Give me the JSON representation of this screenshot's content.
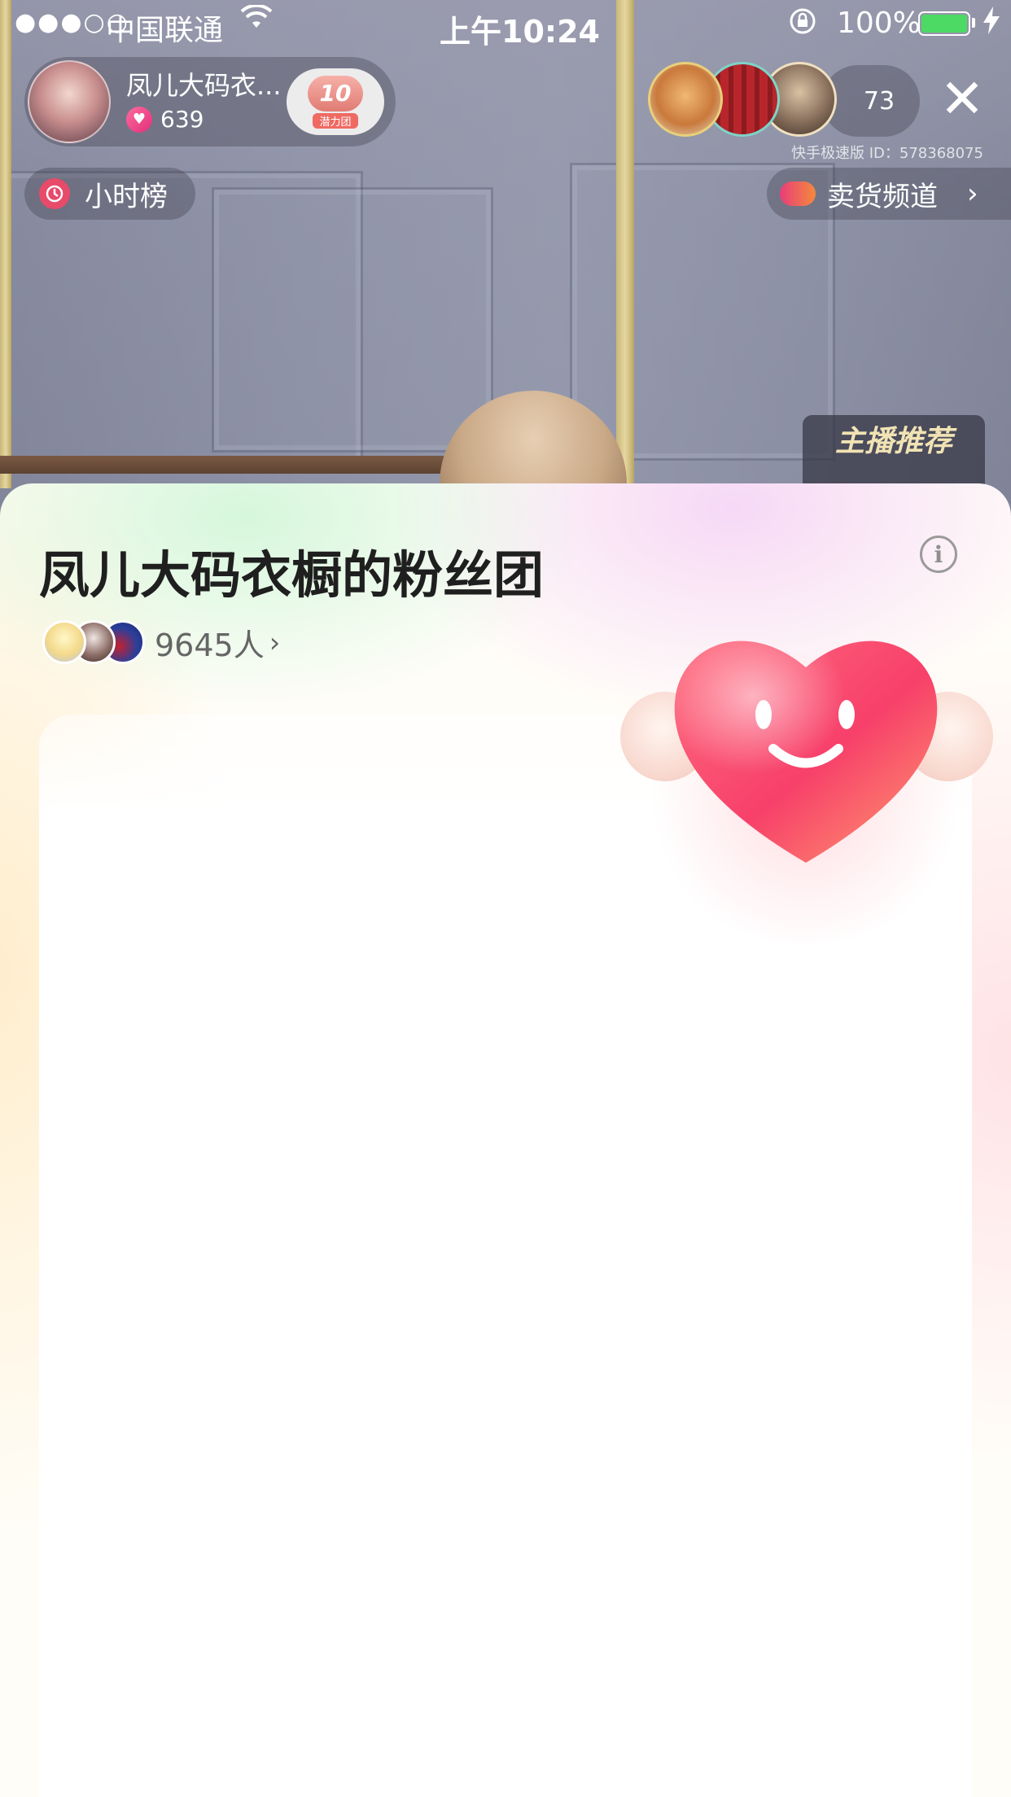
{
  "status_bar": {
    "signal": "●●●○○",
    "carrier": "中国联通",
    "wifi_icon": "wifi-icon",
    "time": "上午10:24",
    "lock_icon": "rotation-lock-icon",
    "battery_percent": "100%",
    "battery_level": 1.0,
    "charging_icon": "bolt-icon"
  },
  "streamer": {
    "name": "凤儿大码衣...",
    "likes": "639",
    "heart_icon": "heart-icon",
    "fan_level": "10",
    "fan_level_label": "潜力团"
  },
  "viewers": {
    "count": "73",
    "avatars": [
      "cat-avatar",
      "red-pattern-avatar",
      "woman-avatar"
    ]
  },
  "app_id": "快手极速版 ID：578368075",
  "hour_rank": {
    "label": "小时榜",
    "icon": "clock-icon"
  },
  "sell_channel": {
    "label": "卖货频道",
    "icon": "channel-icon",
    "chevron": "›"
  },
  "anchor_recommend": "主播推荐",
  "fan_club_sheet": {
    "title": "凤儿大码衣橱的粉丝团",
    "info_icon": "i",
    "member_count": "9645人",
    "member_chevron": "›",
    "mascot": "winged-heart-mascot"
  },
  "colors": {
    "accent_pink": "#e84a6a",
    "battery_green": "#4cd964",
    "title_text": "#1f1f1f"
  }
}
